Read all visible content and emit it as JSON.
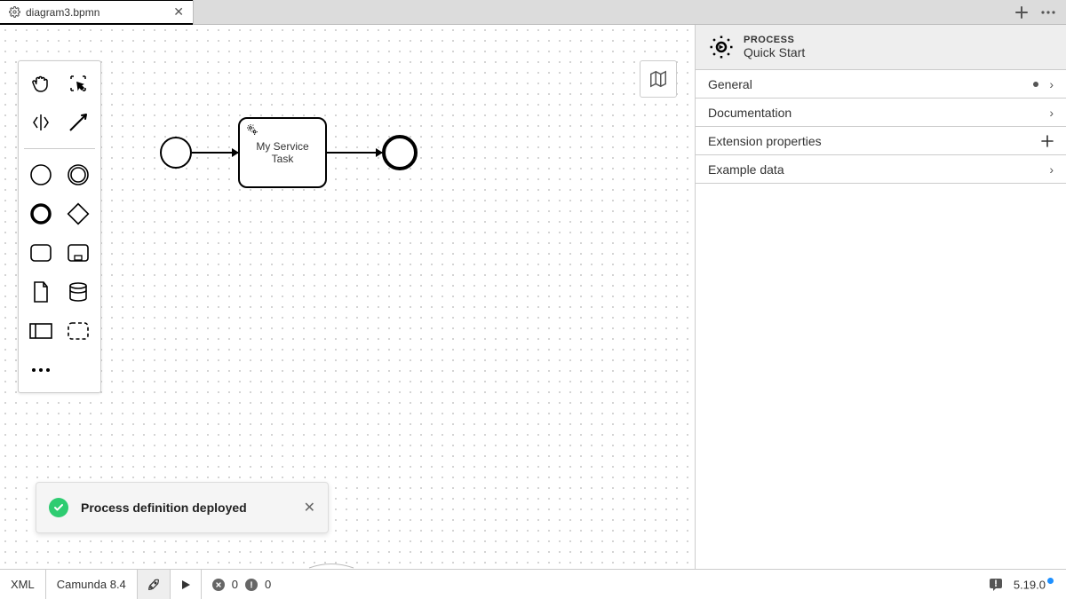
{
  "tab": {
    "title": "diagram3.bpmn"
  },
  "diagram": {
    "task_label_line1": "My Service",
    "task_label_line2": "Task"
  },
  "toast": {
    "message": "Process definition deployed"
  },
  "props": {
    "type_label": "PROCESS",
    "name": "Quick Start",
    "rows": [
      {
        "label": "General",
        "indicator": "dot"
      },
      {
        "label": "Documentation",
        "indicator": "chev"
      },
      {
        "label": "Extension properties",
        "indicator": "plus"
      },
      {
        "label": "Example data",
        "indicator": "chev"
      }
    ]
  },
  "status": {
    "xml": "XML",
    "engine": "Camunda 8.4",
    "errors": "0",
    "warnings": "0",
    "version": "5.19.0"
  }
}
